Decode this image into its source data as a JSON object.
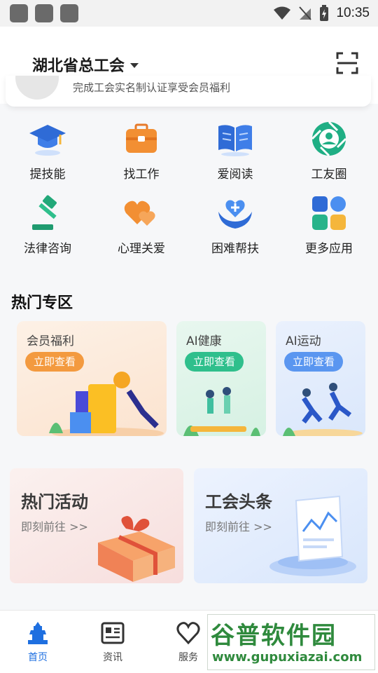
{
  "status_bar": {
    "time": "10:35"
  },
  "header": {
    "org_name": "湖北省总工会",
    "notice_text": "完成工会实名制认证享受会员福利"
  },
  "apps": [
    {
      "label": "提技能",
      "icon": "graduation-cap-icon"
    },
    {
      "label": "找工作",
      "icon": "briefcase-icon"
    },
    {
      "label": "爱阅读",
      "icon": "open-book-icon"
    },
    {
      "label": "工友圈",
      "icon": "camera-aperture-icon"
    },
    {
      "label": "法律咨询",
      "icon": "gavel-icon"
    },
    {
      "label": "心理关爱",
      "icon": "hearts-icon"
    },
    {
      "label": "困难帮扶",
      "icon": "helping-hand-icon"
    },
    {
      "label": "更多应用",
      "icon": "more-apps-icon"
    }
  ],
  "hot_zone": {
    "title": "热门专区",
    "cards": [
      {
        "title": "会员福利",
        "button": "立即查看"
      },
      {
        "title": "AI健康",
        "button": "立即查看"
      },
      {
        "title": "AI运动",
        "button": "立即查看"
      }
    ]
  },
  "banners": [
    {
      "title": "热门活动",
      "subtitle": "即刻前往 >>"
    },
    {
      "title": "工会头条",
      "subtitle": "即刻前往 >>"
    }
  ],
  "bottom_nav": [
    {
      "label": "首页",
      "icon": "home-tower-icon",
      "active": true
    },
    {
      "label": "资讯",
      "icon": "news-icon",
      "active": false
    },
    {
      "label": "服务",
      "icon": "heart-icon",
      "active": false
    }
  ],
  "watermark": {
    "line1": "谷普软件园",
    "line2": "www.gupuxiazai.com"
  },
  "colors": {
    "accent": "#1e6fe0",
    "orange": "#f18a2d",
    "green": "#27b38a",
    "blue": "#4b8ff0"
  }
}
